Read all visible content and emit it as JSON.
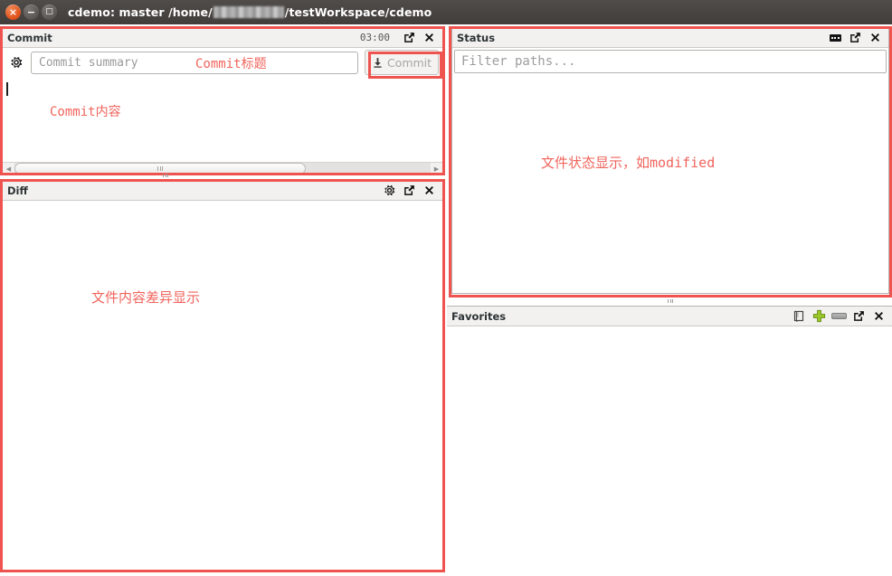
{
  "window": {
    "title_prefix": "cdemo: master /home/",
    "title_suffix": "/testWorkspace/cdemo",
    "controls": {
      "close": "×",
      "minimize": "−",
      "maximize": "□"
    }
  },
  "commit_panel": {
    "title": "Commit",
    "time": "03:00",
    "icons": [
      "popout-icon",
      "close-icon"
    ],
    "gear_icon": "gear-icon",
    "summary_placeholder": "Commit summary",
    "summary_value": "",
    "commit_button_label": "Commit",
    "commit_button_icon": "download-arrow-icon",
    "message_value": "",
    "annotations": {
      "summary": "Commit标题",
      "message": "Commit内容"
    },
    "scrollbar": {
      "left_arrow": "◀",
      "right_arrow": "▶",
      "thumb_width_pct": 70
    }
  },
  "status_panel": {
    "title": "Status",
    "icons": [
      "options-dots-icon",
      "popout-icon",
      "close-icon"
    ],
    "filter_placeholder": "Filter paths...",
    "filter_value": "",
    "annotation": "文件状态显示，如modified"
  },
  "diff_panel": {
    "title": "Diff",
    "icons": [
      "gear-icon",
      "popout-icon",
      "close-icon"
    ],
    "annotation": "文件内容差异显示"
  },
  "favorites_panel": {
    "title": "Favorites",
    "icons": [
      "bookmark-icon",
      "add-icon",
      "remove-icon",
      "popout-icon",
      "close-icon"
    ]
  },
  "colors": {
    "annotation_red": "#ef5350",
    "annotation_text": "#f0645c",
    "titlebar": "#45413f",
    "panel_header": "#f2f1f0",
    "add_green": "#8cb820"
  }
}
